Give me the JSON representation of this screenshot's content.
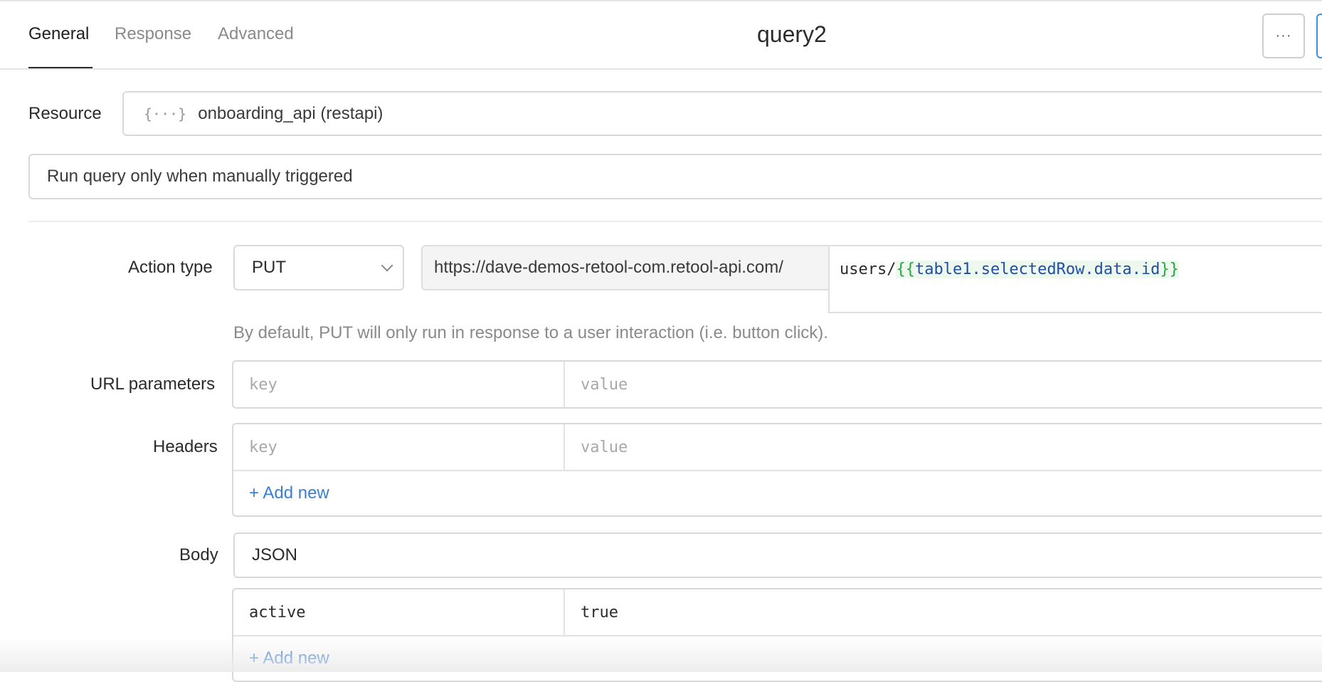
{
  "tabs": [
    {
      "label": "General",
      "active": true
    },
    {
      "label": "Response",
      "active": false
    },
    {
      "label": "Advanced",
      "active": false
    }
  ],
  "query": {
    "name": "query2"
  },
  "toolbar": {
    "more_label": "···"
  },
  "resource": {
    "label": "Resource",
    "icon": "rest-api-icon",
    "value": "onboarding_api (restapi)"
  },
  "trigger": {
    "value": "Run query only when manually triggered"
  },
  "action": {
    "label": "Action type",
    "method": "PUT",
    "base_url": "https://dave-demos-retool-com.retool-api.com/",
    "path_prefix": "users/",
    "path_open": "{{",
    "path_expr": "table1.selectedRow.data.id",
    "path_close": "}}",
    "hint": "By default, PUT will only run in response to a user interaction (i.e. button click)."
  },
  "url_params": {
    "label": "URL parameters",
    "key_placeholder": "key",
    "value_placeholder": "value"
  },
  "headers": {
    "label": "Headers",
    "key_placeholder": "key",
    "value_placeholder": "value",
    "add_label": "+ Add new"
  },
  "body": {
    "label": "Body",
    "type": "JSON",
    "rows": [
      {
        "key": "active",
        "value": "true"
      }
    ],
    "add_label": "+ Add new"
  },
  "colors": {
    "accent": "#3a7fd0",
    "template_brace": "#23a83f",
    "template_expr": "#1f4fa3"
  }
}
